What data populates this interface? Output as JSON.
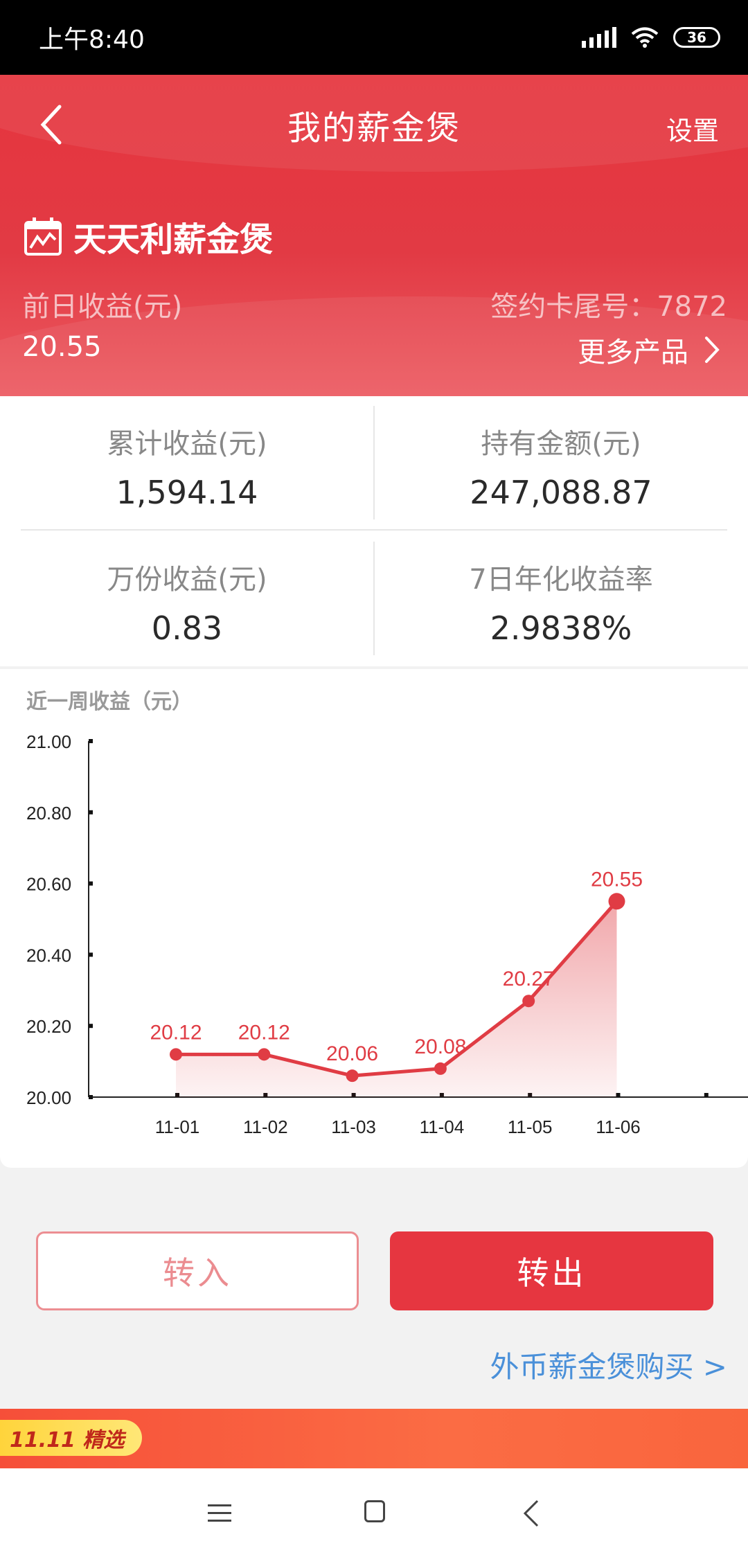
{
  "status_bar": {
    "time": "上午8:40",
    "battery": "36"
  },
  "header": {
    "title": "我的薪金煲",
    "settings_label": "设置",
    "product_name": "天天利薪金煲",
    "yesterday_label": "前日收益(元)",
    "yesterday_value": "20.55",
    "card_label": "签约卡尾号：7872",
    "more_products_label": "更多产品"
  },
  "stats": [
    {
      "label": "累计收益(元)",
      "value": "1,594.14"
    },
    {
      "label": "持有金额(元)",
      "value": "247,088.87"
    },
    {
      "label": "万份收益(元)",
      "value": "0.83"
    },
    {
      "label": "7日年化收益率",
      "value": "2.9838%"
    }
  ],
  "chart_title": "近一周收益（元）",
  "chart_data": {
    "type": "area",
    "categories": [
      "11-01",
      "11-02",
      "11-03",
      "11-04",
      "11-05",
      "11-06"
    ],
    "values": [
      20.12,
      20.12,
      20.06,
      20.08,
      20.27,
      20.55
    ],
    "ylim": [
      20.0,
      21.0
    ],
    "yticks": [
      "20.00",
      "20.20",
      "20.40",
      "20.60",
      "20.80",
      "21.00"
    ],
    "color": "#e03c44"
  },
  "actions": {
    "transfer_in": "转入",
    "transfer_out": "转出",
    "foreign_link": "外币薪金煲购买 >"
  },
  "banner": {
    "tag": "11.11 精选"
  },
  "colors": {
    "accent": "#e63640",
    "link": "#4a90d9"
  }
}
